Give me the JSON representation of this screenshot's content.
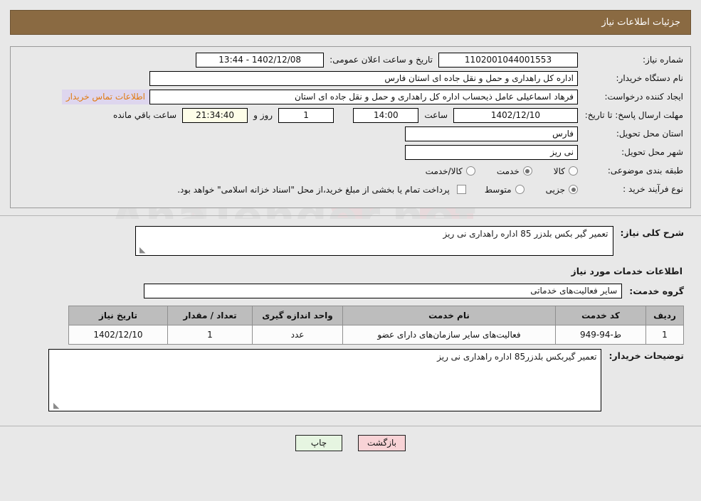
{
  "header": {
    "title": "جزئیات اطلاعات نیاز"
  },
  "watermark": {
    "text": "AnaTender.net"
  },
  "summary": {
    "need_number_label": "شماره نیاز:",
    "need_number_value": "1102001044001553",
    "announce_label": "تاریخ و ساعت اعلان عمومی:",
    "announce_value": "1402/12/08 - 13:44",
    "buyer_org_label": "نام دستگاه خریدار:",
    "buyer_org_value": "اداره کل راهداری و حمل و نقل جاده ای استان فارس",
    "requester_label": "ایجاد کننده درخواست:",
    "requester_value": "فرهاد اسماعیلی عامل ذیحساب اداره کل راهداری و حمل و نقل جاده ای استان",
    "contact_link": "اطلاعات تماس خریدار",
    "deadline_label": "مهلت ارسال پاسخ: تا تاریخ:",
    "deadline_date": "1402/12/10",
    "hour_label": "ساعت",
    "deadline_time": "14:00",
    "days_value": "1",
    "days_label": "روز و",
    "countdown_value": "21:34:40",
    "countdown_label": "ساعت باقي مانده",
    "province_label": "استان محل تحویل:",
    "province_value": "فارس",
    "city_label": "شهر محل تحویل:",
    "city_value": "نی ریز",
    "category_label": "طبقه بندی موضوعی:",
    "category_options": [
      {
        "label": "کالا",
        "selected": false
      },
      {
        "label": "خدمت",
        "selected": true
      },
      {
        "label": "کالا/خدمت",
        "selected": false
      }
    ],
    "process_label": "نوع فرآیند خرید :",
    "process_options": [
      {
        "label": "جزیی",
        "selected": true
      },
      {
        "label": "متوسط",
        "selected": false
      }
    ],
    "islamic_treasury_note": "پرداخت تمام یا بخشی از مبلغ خرید،از محل \"اسناد خزانه اسلامی\" خواهد بود."
  },
  "details": {
    "overview_label": "شرح کلی نیاز:",
    "overview_value": "تعمیر گیر بکس بلدزر 85 اداره راهداری نی ریز",
    "services_heading": "اطلاعات خدمات مورد نیاز",
    "service_group_label": "گروه خدمت:",
    "service_group_value": "سایر فعالیت‌های خدماتی"
  },
  "table": {
    "columns": [
      "ردیف",
      "کد خدمت",
      "نام خدمت",
      "واحد اندازه گیری",
      "تعداد / مقدار",
      "تاریخ نیاز"
    ],
    "rows": [
      {
        "radif": "1",
        "code": "ط-94-949",
        "name": "فعالیت‌های سایر سازمان‌های دارای عضو",
        "unit": "عدد",
        "qty": "1",
        "date": "1402/12/10"
      }
    ]
  },
  "buyer_notes": {
    "label": "توضیحات خریدار:",
    "value": "تعمیر گیربکس بلدزر85 اداره راهداری نی ریز"
  },
  "footer": {
    "print_label": "چاپ",
    "back_label": "بازگشت"
  }
}
